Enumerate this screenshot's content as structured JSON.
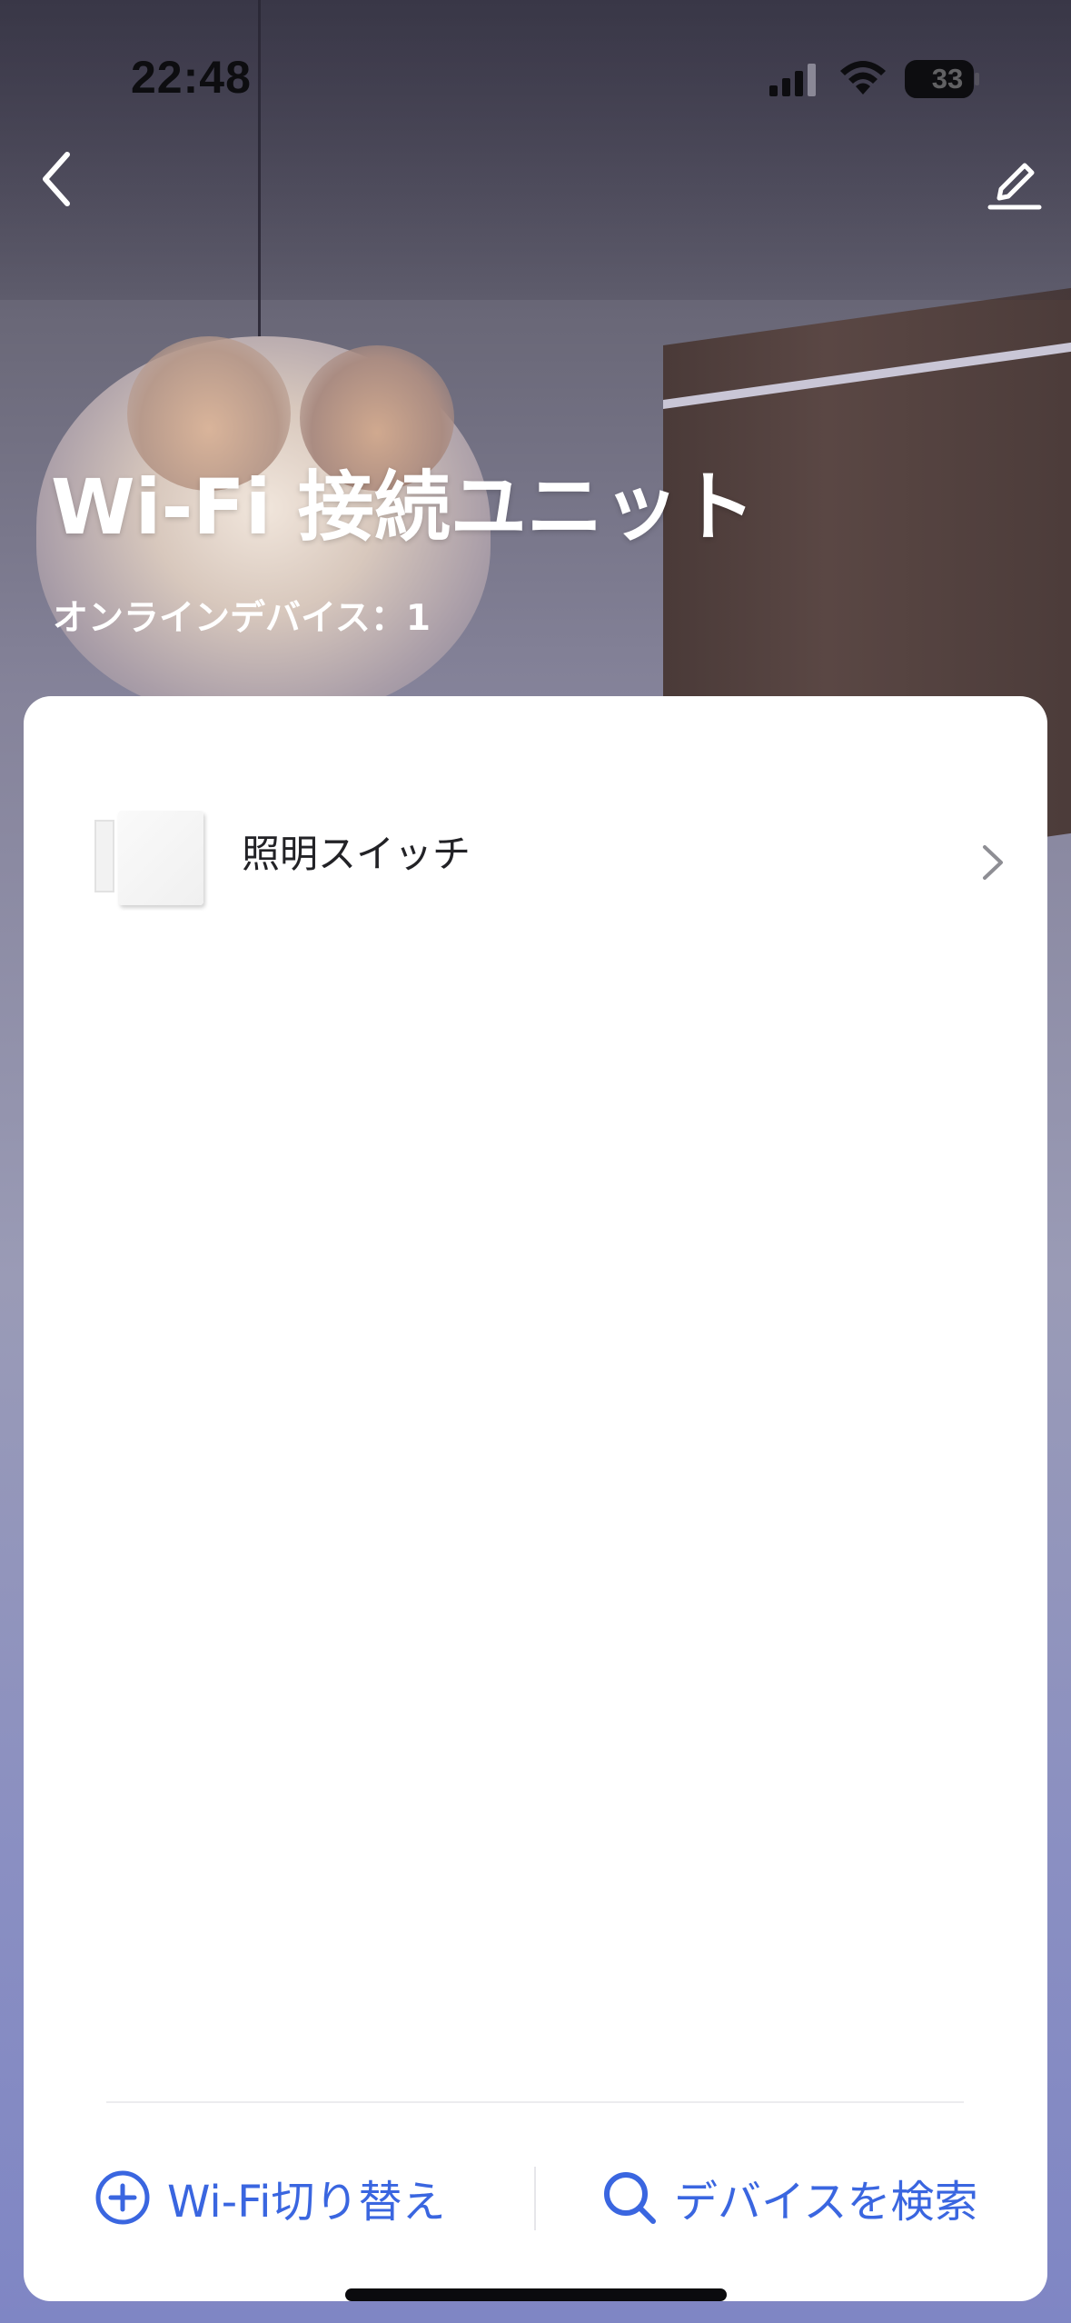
{
  "status_bar": {
    "time": "22:48",
    "battery_level": "33",
    "signal_icon": "cellular-signal-icon",
    "wifi_icon": "wifi-icon",
    "battery_icon": "battery-icon"
  },
  "nav": {
    "back_icon": "chevron-left-icon",
    "edit_icon": "pencil-edit-icon"
  },
  "header": {
    "title": "Wi-Fi 接続ユニット",
    "online_devices": "オンラインデバイス：1"
  },
  "devices": [
    {
      "name": "照明スイッチ",
      "thumbnail_icon": "light-switch-thumbnail",
      "chevron_icon": "chevron-right-icon"
    }
  ],
  "actions": {
    "switch_wifi_label": "Wi-Fi切り替え",
    "switch_wifi_icon": "plus-circle-icon",
    "search_device_label": "デバイスを検索",
    "search_device_icon": "search-icon"
  },
  "colors": {
    "accent": "#3a66e0",
    "card_background": "#ffffff",
    "title_text": "#ffffff"
  }
}
